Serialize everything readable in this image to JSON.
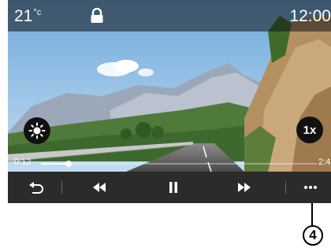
{
  "status_bar": {
    "temperature": "21",
    "temperature_unit": "°c",
    "time": "12:00"
  },
  "video": {
    "elapsed": "0:12",
    "remaining": "2:4",
    "progress_fraction": 0.1
  },
  "overlay": {
    "speed_label": "1x"
  },
  "icons": {
    "lock": "lock-icon",
    "brightness": "brightness-icon",
    "back": "back-icon",
    "rewind": "rewind-icon",
    "pause": "pause-icon",
    "fast_forward": "fast-forward-icon",
    "more": "more-icon"
  },
  "callout": {
    "label": "4"
  },
  "colors": {
    "control_bar": "#2b2b2b",
    "overlay_button": "#111111",
    "text": "#ffffff"
  }
}
